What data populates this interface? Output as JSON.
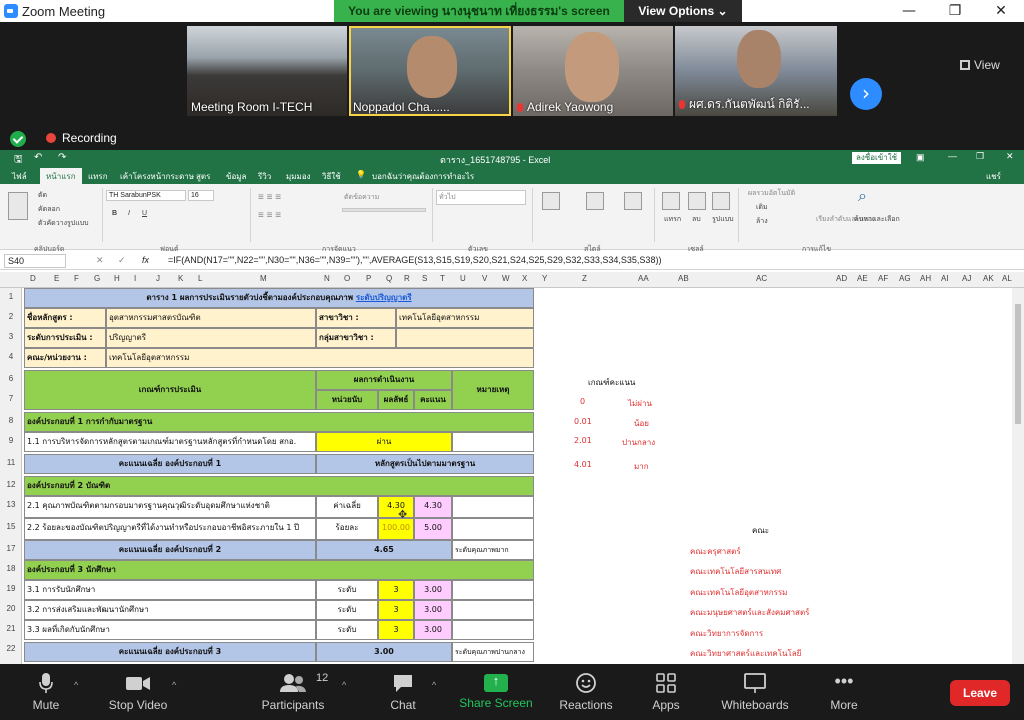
{
  "zoom": {
    "window_title": "Zoom Meeting",
    "share_banner": "You are viewing นางนุชนาท  เที่ยงธรรม's screen",
    "view_options": "View Options",
    "view_label": "View",
    "recording": "Recording",
    "participants": [
      {
        "name": "Meeting Room I-TECH",
        "muted": false
      },
      {
        "name": "Noppadol  Cha......",
        "muted": false
      },
      {
        "name": "Adirek Yaowong",
        "muted": true
      },
      {
        "name": "ผศ.ดร.กันตพัฒน์  กิติรั...",
        "muted": true
      }
    ],
    "toolbar": {
      "mute": "Mute",
      "stop_video": "Stop Video",
      "participants": "Participants",
      "participant_count": "12",
      "chat": "Chat",
      "share_screen": "Share Screen",
      "reactions": "Reactions",
      "apps": "Apps",
      "whiteboards": "Whiteboards",
      "more": "More",
      "leave": "Leave"
    },
    "colors": {
      "accent": "#2d8cff",
      "share_green": "#37b24d",
      "leave_red": "#e02828"
    }
  },
  "excel": {
    "file_name": "ตาราง_1651748795 - Excel",
    "sign_in": "ลงชื่อเข้าใช้",
    "user": "แชร์",
    "tabs": [
      "ไฟล์",
      "หน้าแรก",
      "แทรก",
      "เค้าโครงหน้ากระดาษ",
      "สูตร",
      "ข้อมูล",
      "รีวิว",
      "มุมมอง",
      "วิธีใช้",
      "บอกฉันว่าคุณต้องการทำอะไร"
    ],
    "ribbon": {
      "clipboard": "คลิปบอร์ด",
      "font_group": "ฟอนต์",
      "alignment": "การจัดแนว",
      "number": "ตัวเลข",
      "styles": "สไตล์",
      "cells": "เซลล์",
      "editing": "การแก้ไข",
      "font_name": "TH SarabunPSK",
      "font_size": "16",
      "cut": "ตัด",
      "copy": "คัดลอก",
      "format_painter": "ตัวคัดวางรูปแบบ",
      "wrap": "ตัดข้อความ",
      "number_format": "ทั่วไป",
      "insert": "แทรก",
      "delete": "ลบ",
      "format": "รูปแบบ",
      "sum": "ผลรวมอัตโนมัติ",
      "fill": "เติม",
      "clear": "ล้าง",
      "sort": "เรียงลำดับและกรอง",
      "find": "ค้นหาและเลือก"
    },
    "name_box": "S40",
    "formula": "=IF(AND(N17=\"\",N22=\"\",N30=\"\",N36=\"\",N39=\"\"),\"\",AVERAGE(S13,S15,S19,S20,S21,S24,S25,S29,S32,S33,S34,S35,S38))",
    "columns": [
      "D",
      "E",
      "F",
      "G",
      "H",
      "I",
      "J",
      "K",
      "L",
      "M",
      "N",
      "O",
      "P",
      "Q",
      "R",
      "S",
      "T",
      "U",
      "V",
      "W",
      "X",
      "Y",
      "Z",
      "AA",
      "AB",
      "AC",
      "AD",
      "AE",
      "AF",
      "AG",
      "AH",
      "AI",
      "AJ",
      "AK",
      "AL"
    ],
    "rows": [
      "1",
      "2",
      "3",
      "4",
      "6",
      "7",
      "8",
      "9",
      "11",
      "12",
      "13",
      "15",
      "17",
      "18",
      "19",
      "20",
      "21",
      "22"
    ],
    "sheet": {
      "title": "ตาราง 1 ผลการประเมินรายตัวบ่งชี้ตามองค์ประกอบคุณภาพ",
      "title_link": "ระดับปริญญาตรี",
      "course_label": "ชื่อหลักสูตร :",
      "course": "อุตสาหกรรมศาสตรบัณฑิต",
      "major_label": "สาขาวิชา :",
      "major": "เทคโนโลยีอุตสาหกรรม",
      "level_label": "ระดับการประเมิน :",
      "level": "ปริญญาตรี",
      "group_label": "กลุ่มสาขาวิชา :",
      "faculty_label": "คณะ/หน่วยงาน :",
      "faculty": "เทคโนโลยีอุตสาหกรรม",
      "h_criteria": "เกณฑ์การประเมิน",
      "h_results": "ผลการดำเนินงาน",
      "h_unit": "หน่วยนับ",
      "h_outcome": "ผลลัพธ์",
      "h_score": "คะแนน",
      "h_note": "หมายเหตุ",
      "comp1": "องค์ประกอบที่ 1 การกำกับมาตรฐาน",
      "r9": "1.1 การบริหารจัดการหลักสูตรตามเกณฑ์มาตรฐานหลักสูตรที่กำหนดโดย สกอ.",
      "r9_result": "ผ่าน",
      "avg1": "คะแนนเฉลี่ย องค์ประกอบที่ 1",
      "avg1_val": "หลักสูตรเป็นไปตามมาตรฐาน",
      "comp2": "องค์ประกอบที่ 2 บัณฑิต",
      "r13": "2.1 คุณภาพบัณฑิตตามกรอบมาตรฐานคุณวุฒิระดับอุดมศึกษาแห่งชาติ",
      "r13_unit": "ค่าเฉลี่ย",
      "r13_outcome": "4.30",
      "r13_score": "4.30",
      "r15": "2.2 ร้อยละของบัณฑิตปริญญาตรีที่ได้งานทำหรือประกอบอาชีพอิสระภายใน 1 ปี",
      "r15_unit": "ร้อยละ",
      "r15_outcome": "100.00",
      "r15_score": "5.00",
      "avg2": "คะแนนเฉลี่ย องค์ประกอบที่ 2",
      "avg2_val": "4.65",
      "avg2_note": "ระดับคุณภาพมาก",
      "comp3": "องค์ประกอบที่ 3 นักศึกษา",
      "r19": "3.1 การรับนักศึกษา",
      "r20": "3.2 การส่งเสริมและพัฒนานักศึกษา",
      "r21": "3.3 ผลที่เกิดกับนักศึกษา",
      "r_unit": "ระดับ",
      "r_outcome": "3",
      "r_score": "3.00",
      "avg3": "คะแนนเฉลี่ย องค์ประกอบที่ 3",
      "avg3_val": "3.00",
      "avg3_note": "ระดับคุณภาพปานกลาง"
    },
    "legend": {
      "title": "เกณฑ์คะแนน",
      "items": [
        {
          "score": "0",
          "label": "ไม่ผ่าน"
        },
        {
          "score": "0.01",
          "label": "น้อย"
        },
        {
          "score": "2.01",
          "label": "ปานกลาง"
        },
        {
          "score": "4.01",
          "label": "มาก"
        }
      ]
    },
    "faculties": {
      "title": "คณะ",
      "items": [
        "คณะครุศาสตร์",
        "คณะเทคโนโลยีสารสนเทศ",
        "คณะเทคโนโลยีอุตสาหกรรม",
        "คณะมนุษยศาสตร์และสังคมศาสตร์",
        "คณะวิทยาการจัดการ",
        "คณะวิทยาศาสตร์และเทคโนโลยี"
      ]
    }
  }
}
